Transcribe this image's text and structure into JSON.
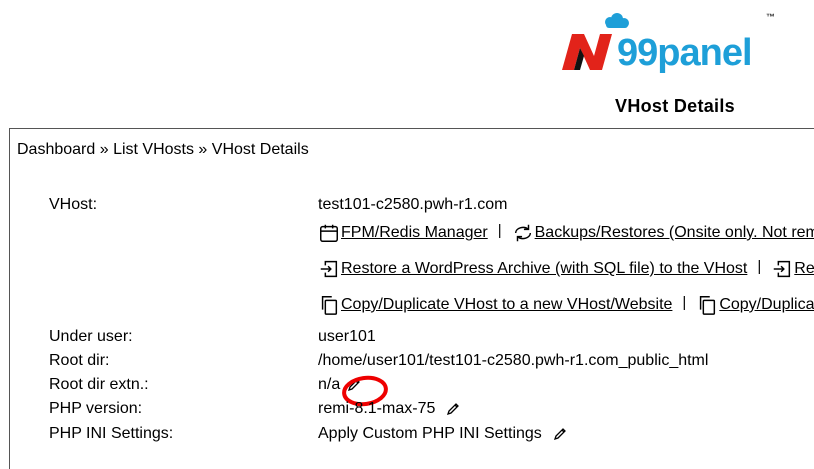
{
  "brand": {
    "logo_text": "99panel",
    "logo_letter": "N",
    "tm": "™",
    "accent": "#e2231a",
    "brand_blue": "#1e9fd8"
  },
  "page": {
    "title": "VHost Details"
  },
  "breadcrumb": {
    "text": "Dashboard » List VHosts » VHost Details"
  },
  "details": {
    "vhost_label": "VHost:",
    "vhost_value": "test101-c2580.pwh-r1.com",
    "under_user_label": "Under user:",
    "under_user_value": "user101",
    "root_dir_label": "Root dir:",
    "root_dir_value": "/home/user101/test101-c2580.pwh-r1.com_public_html",
    "root_dir_extn_label": "Root dir extn.:",
    "root_dir_extn_value": "n/a",
    "php_version_label": "PHP version:",
    "php_version_value": "remi-8.1-max-75",
    "php_ini_label": "PHP INI Settings:",
    "php_ini_value": "Apply Custom PHP INI Settings"
  },
  "actions": {
    "row1": [
      "FPM/Redis Manager",
      "Backups/Restores (Onsite only. Not rem"
    ],
    "row2": [
      "Restore a WordPress Archive (with SQL file) to the VHost",
      "Re"
    ],
    "row3": [
      "Copy/Duplicate VHost to a new VHost/Website",
      "Copy/Duplica"
    ],
    "separator": "|"
  },
  "icons": [
    "calendar-icon",
    "refresh-icon",
    "restore-icon",
    "copy-icon",
    "pencil-icon"
  ]
}
